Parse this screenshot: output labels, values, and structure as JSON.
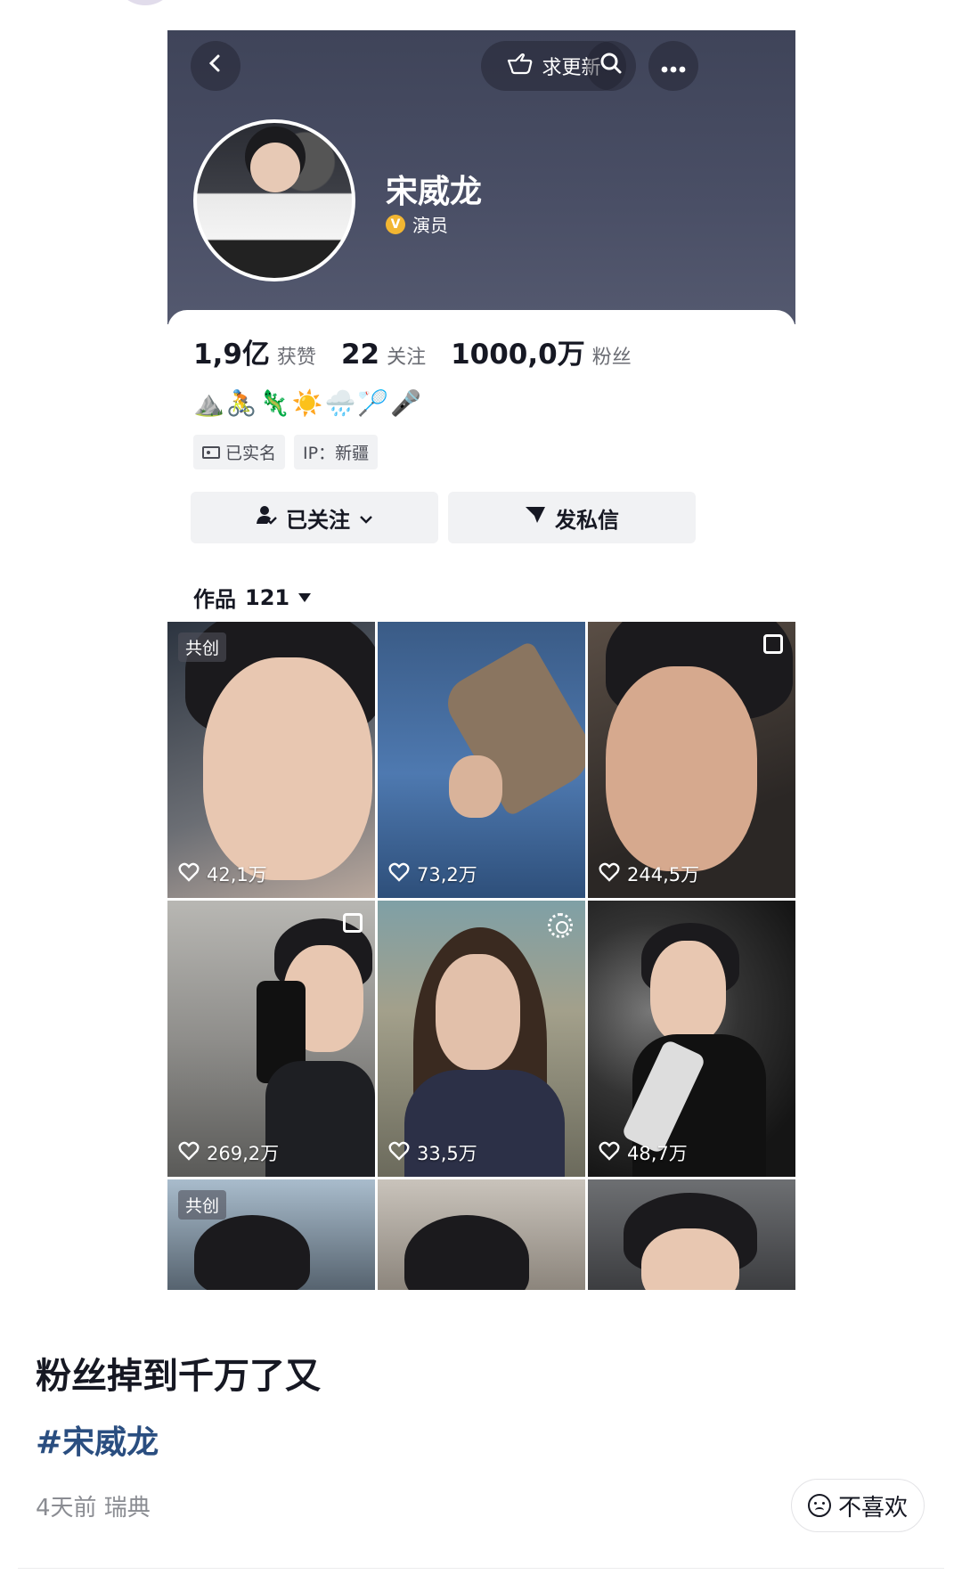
{
  "header": {
    "back_icon": "chevron-left-icon",
    "update_label": "求更新",
    "update_icon": "pointing-hand-icon",
    "search_icon": "search-icon",
    "more_icon": "ellipsis-icon"
  },
  "profile": {
    "name": "宋威龙",
    "verified_icon": "v-badge-icon",
    "verified_badge": "V",
    "role": "演员",
    "stats": [
      {
        "value": "1,9亿",
        "label": "获赞"
      },
      {
        "value": "22",
        "label": "关注"
      },
      {
        "value": "1000,0万",
        "label": "粉丝"
      }
    ],
    "emojis": "⛰️🚴🦎☀️🌧️🏸🎤",
    "tags": {
      "real_name": "已实名",
      "ip": "IP：新疆"
    },
    "follow_button": "已关注",
    "message_button": "发私信"
  },
  "works": {
    "label": "作品",
    "count": "121",
    "items": [
      {
        "likes": "42,1万",
        "badge": "共创"
      },
      {
        "likes": "73,2万"
      },
      {
        "likes": "244,5万"
      },
      {
        "likes": "269,2万"
      },
      {
        "likes": "33,5万"
      },
      {
        "likes": "48,7万"
      },
      {
        "badge": "共创"
      }
    ]
  },
  "post": {
    "title": "粉丝掉到千万了又",
    "hashtag": "#宋威龙",
    "meta": "4天前 瑞典",
    "dislike": "不喜欢"
  },
  "colors": {
    "header_bg": "#4a4f66",
    "verified": "#f2b632",
    "hashtag": "#2a4e80"
  }
}
